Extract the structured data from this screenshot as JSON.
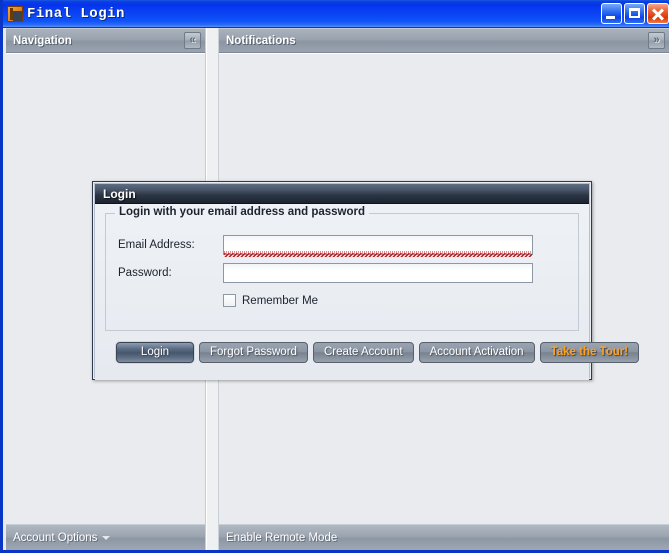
{
  "window": {
    "title": "Final Login",
    "icon": "app-icon",
    "controls": {
      "minimize": "minimize-icon",
      "maximize": "maximize-icon",
      "close": "close-icon"
    }
  },
  "navigation_panel": {
    "header": "Navigation",
    "collapse_button": "«",
    "status": "Account Options",
    "status_has_dropdown": true
  },
  "notifications_panel": {
    "header": "Notifications",
    "expand_button": "»",
    "status": "Enable Remote Mode"
  },
  "dialog": {
    "title": "Login",
    "group_legend": "Login with your email address and password",
    "fields": {
      "email": {
        "label": "Email Address:",
        "value": "",
        "placeholder": "",
        "error": true
      },
      "password": {
        "label": "Password:",
        "value": "",
        "placeholder": ""
      }
    },
    "remember_me": {
      "label": "Remember Me",
      "checked": false
    },
    "buttons": [
      {
        "label": "Login",
        "style": "default"
      },
      {
        "label": "Forgot Password",
        "style": "normal"
      },
      {
        "label": "Create Account",
        "style": "normal"
      },
      {
        "label": "Account Activation",
        "style": "normal"
      },
      {
        "label": "Take the Tour!",
        "style": "tour"
      }
    ]
  },
  "colors": {
    "titlebar_blue": "#0b3fe8",
    "window_border": "#0a36c8",
    "panel_header": "#96a0ac",
    "panel_bg": "#e9ebee",
    "dialog_title": "#2b3442",
    "error_red": "#cc1111",
    "tour_orange": "#ffa023"
  }
}
